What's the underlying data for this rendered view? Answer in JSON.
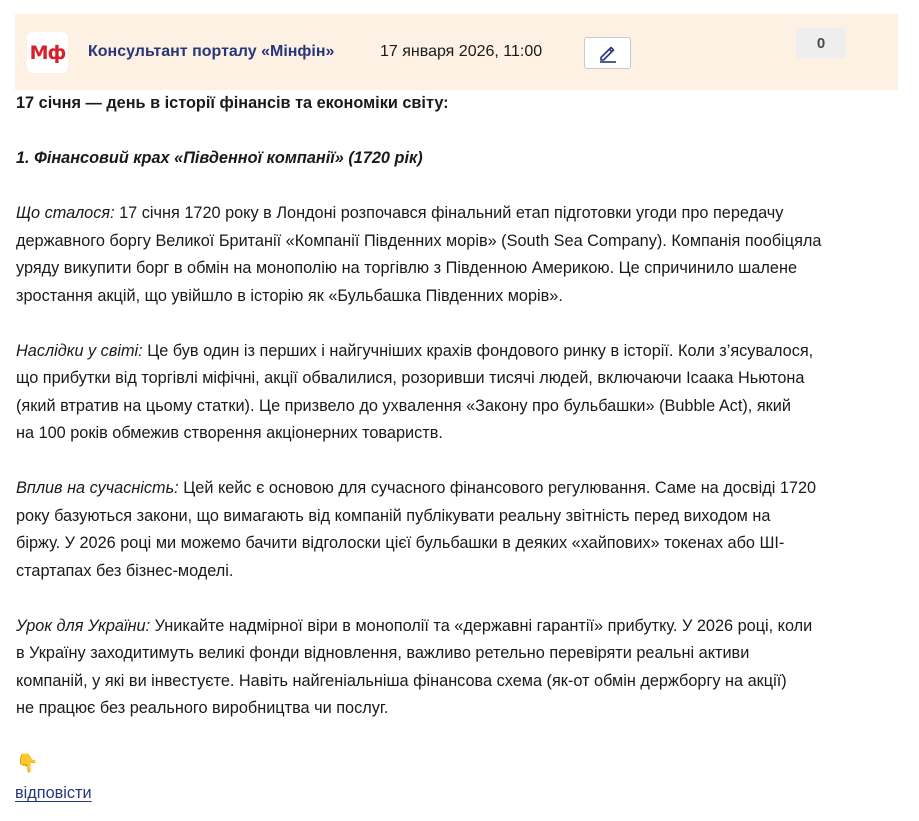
{
  "post": {
    "logo_text": "Мф",
    "author": "Консультант порталу «Мінфін»",
    "date": "17 января 2026, 11:00",
    "counter": "0",
    "edit_icon": "pencil-icon"
  },
  "article": {
    "headline": "17 січня — день в історії фінансів та економіки світу:",
    "section_title": "1. Фінансовий крах «Південної компанії» (1720 рік)",
    "paragraphs": [
      {
        "lead": "Що сталося:",
        "lines": [
          "17 січня 1720 року в Лондоні розпочався фінальний етап підготовки угоди про передачу",
          "державного боргу Великої Британії «Компанії Південних морів» (South Sea Company). Компанія пообіцяла",
          "уряду викупити борг в обмін на монополію на торгівлю з Південною Америкою. Це спричинило шалене",
          "зростання акцій, що увійшло в історію як «Бульбашка Південних морів»."
        ]
      },
      {
        "lead": "Наслідки у світі:",
        "lines": [
          "Це був один із перших і найгучніших крахів фондового ринку в історії. Коли з’ясувалося,",
          "що прибутки від торгівлі міфічні, акції обвалилися, розоривши тисячі людей, включаючи Ісаака Ньютона",
          "(який втратив на цьому статки). Це призвело до ухвалення «Закону про бульбашки» (Bubble Act), який",
          "на 100 років обмежив створення акціонерних товариств."
        ]
      },
      {
        "lead": "Вплив на сучасність:",
        "lines": [
          "Цей кейс є основою для сучасного фінансового регулювання. Саме на досвіді 1720",
          "року базуються закони, що вимагають від компаній публікувати реальну звітність перед виходом на",
          "біржу. У 2026 році ми можемо бачити відголоски цієї бульбашки в деяких «хайпових» токенах або ШІ-",
          "стартапах без бізнес-моделі."
        ]
      },
      {
        "lead": "Урок для України:",
        "lines": [
          "Уникайте надмірної віри в монополії та «державні гарантії» прибутку. У 2026 році, коли",
          "в Україну заходитимуть великі фонди відновлення, важливо ретельно перевіряти реальні активи",
          "компаній, у які ви інвестуєте. Навіть найгеніальніша фінансова схема (як-от обмін держборгу на акції)",
          "не працює без реального виробництва чи послуг."
        ]
      }
    ],
    "emoji": "👇",
    "emoji_icon": "pointing-down-icon",
    "reply_label": "відповісти"
  },
  "colors": {
    "header_bg": "#fcf1e3",
    "brand_red": "#d6202a",
    "link_blue": "#27367a"
  }
}
